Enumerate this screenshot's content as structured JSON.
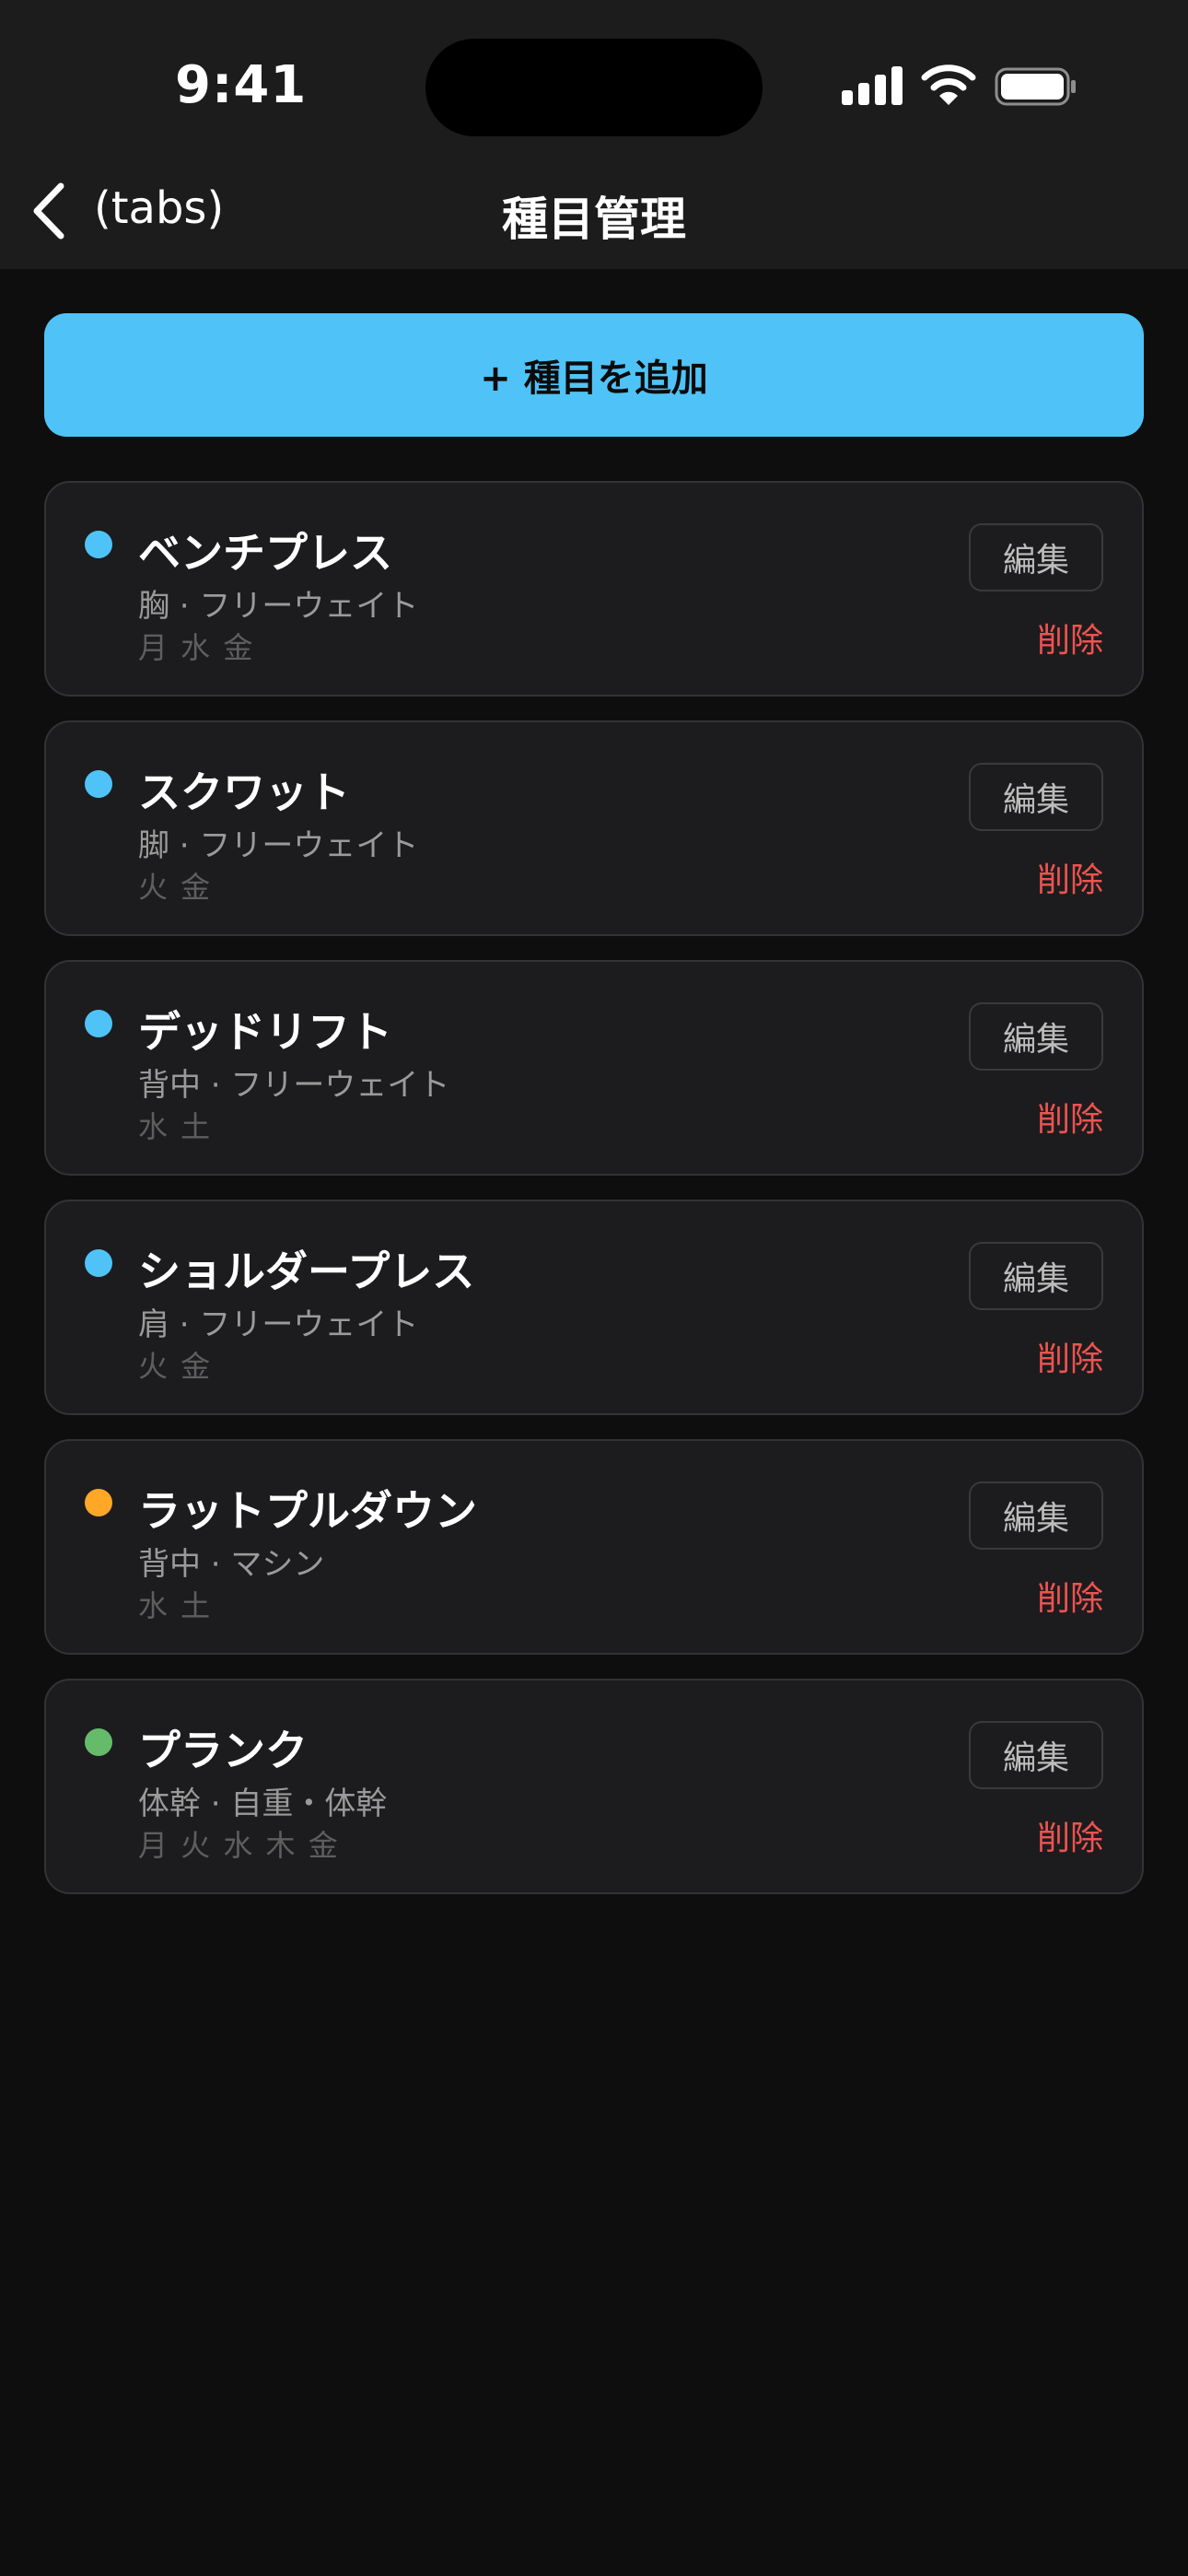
{
  "status_bar": {
    "time": "9:41"
  },
  "nav": {
    "back_label": "(tabs)",
    "title": "種目管理"
  },
  "add_button_label": "+ 種目を追加",
  "exercises": [
    {
      "name": "ベンチプレス",
      "meta": "胸 · フリーウェイト",
      "days": "月 水 金",
      "dot_color": "#4fc3f7",
      "edit_label": "編集",
      "delete_label": "削除"
    },
    {
      "name": "スクワット",
      "meta": "脚 · フリーウェイト",
      "days": "火 金",
      "dot_color": "#4fc3f7",
      "edit_label": "編集",
      "delete_label": "削除"
    },
    {
      "name": "デッドリフト",
      "meta": "背中 · フリーウェイト",
      "days": "水 土",
      "dot_color": "#4fc3f7",
      "edit_label": "編集",
      "delete_label": "削除"
    },
    {
      "name": "ショルダープレス",
      "meta": "肩 · フリーウェイト",
      "days": "火 金",
      "dot_color": "#4fc3f7",
      "edit_label": "編集",
      "delete_label": "削除"
    },
    {
      "name": "ラットプルダウン",
      "meta": "背中 · マシン",
      "days": "水 土",
      "dot_color": "#ffa726",
      "edit_label": "編集",
      "delete_label": "削除"
    },
    {
      "name": "プランク",
      "meta": "体幹 · 自重・体幹",
      "days": "月 火 水 木 金",
      "dot_color": "#66bb6a",
      "edit_label": "編集",
      "delete_label": "削除"
    }
  ],
  "colors": {
    "accent": "#4fc3f7",
    "danger": "#ef5350",
    "background": "#0e0e0e",
    "card": "#1c1c1e"
  },
  "icons": {
    "back": "chevron-left-icon",
    "signal": "cellular-signal-icon",
    "wifi": "wifi-icon",
    "battery": "battery-icon"
  }
}
